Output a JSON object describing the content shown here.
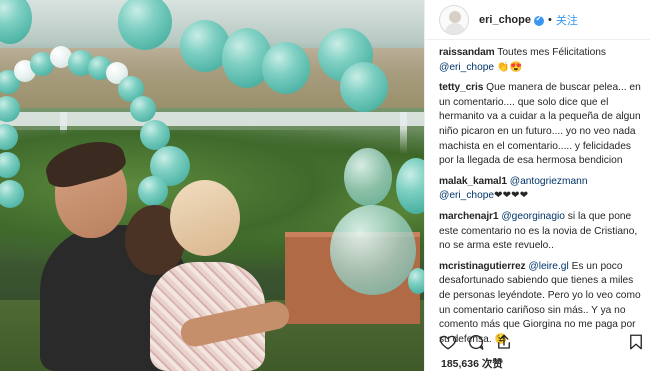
{
  "header": {
    "username": "eri_chope",
    "separator": "•",
    "follow_label": "关注"
  },
  "comments": [
    {
      "user": "raissandam",
      "text": "Toutes mes Félicitations",
      "mention": "@eri_chope",
      "suffix": " 👏😍"
    },
    {
      "user": "tetty_cris",
      "text": "Que manera de buscar pelea... en un comentario.... que solo dice que el hermanito va a cuidar a la pequeña de algun niño picaron en un futuro.... yo no veo nada machista en el comentario..... y felicidades por la llegada de esa hermosa bendicion"
    },
    {
      "user": "malak_kamal1",
      "mention": "@antogriezmann",
      "mention2": "@eri_chope",
      "suffix": "❤❤❤❤"
    },
    {
      "user": "marchenajr1",
      "mention": "@georginagio",
      "text": "si la que pone este comentario no es la novia de Cristiano, no se arma este revuelo.."
    },
    {
      "user": "mcristinagutierrez",
      "mention": "@leire.gl",
      "text": "Es un poco desafortunado sabiendo que tienes a miles de personas leyéndote. Pero yo lo veo como un comentario cariñoso sin más.. Y ya no comento más que Giorgina no me paga por su defensa. 😉"
    }
  ],
  "likes": {
    "count": "185,636",
    "label": "次赞"
  },
  "icons": [
    "heart-icon",
    "comment-icon",
    "share-icon",
    "bookmark-icon",
    "verified-badge-icon"
  ],
  "colors": {
    "accent": "#3897f0",
    "mention": "#003569",
    "balloon": "#56b9aa"
  }
}
